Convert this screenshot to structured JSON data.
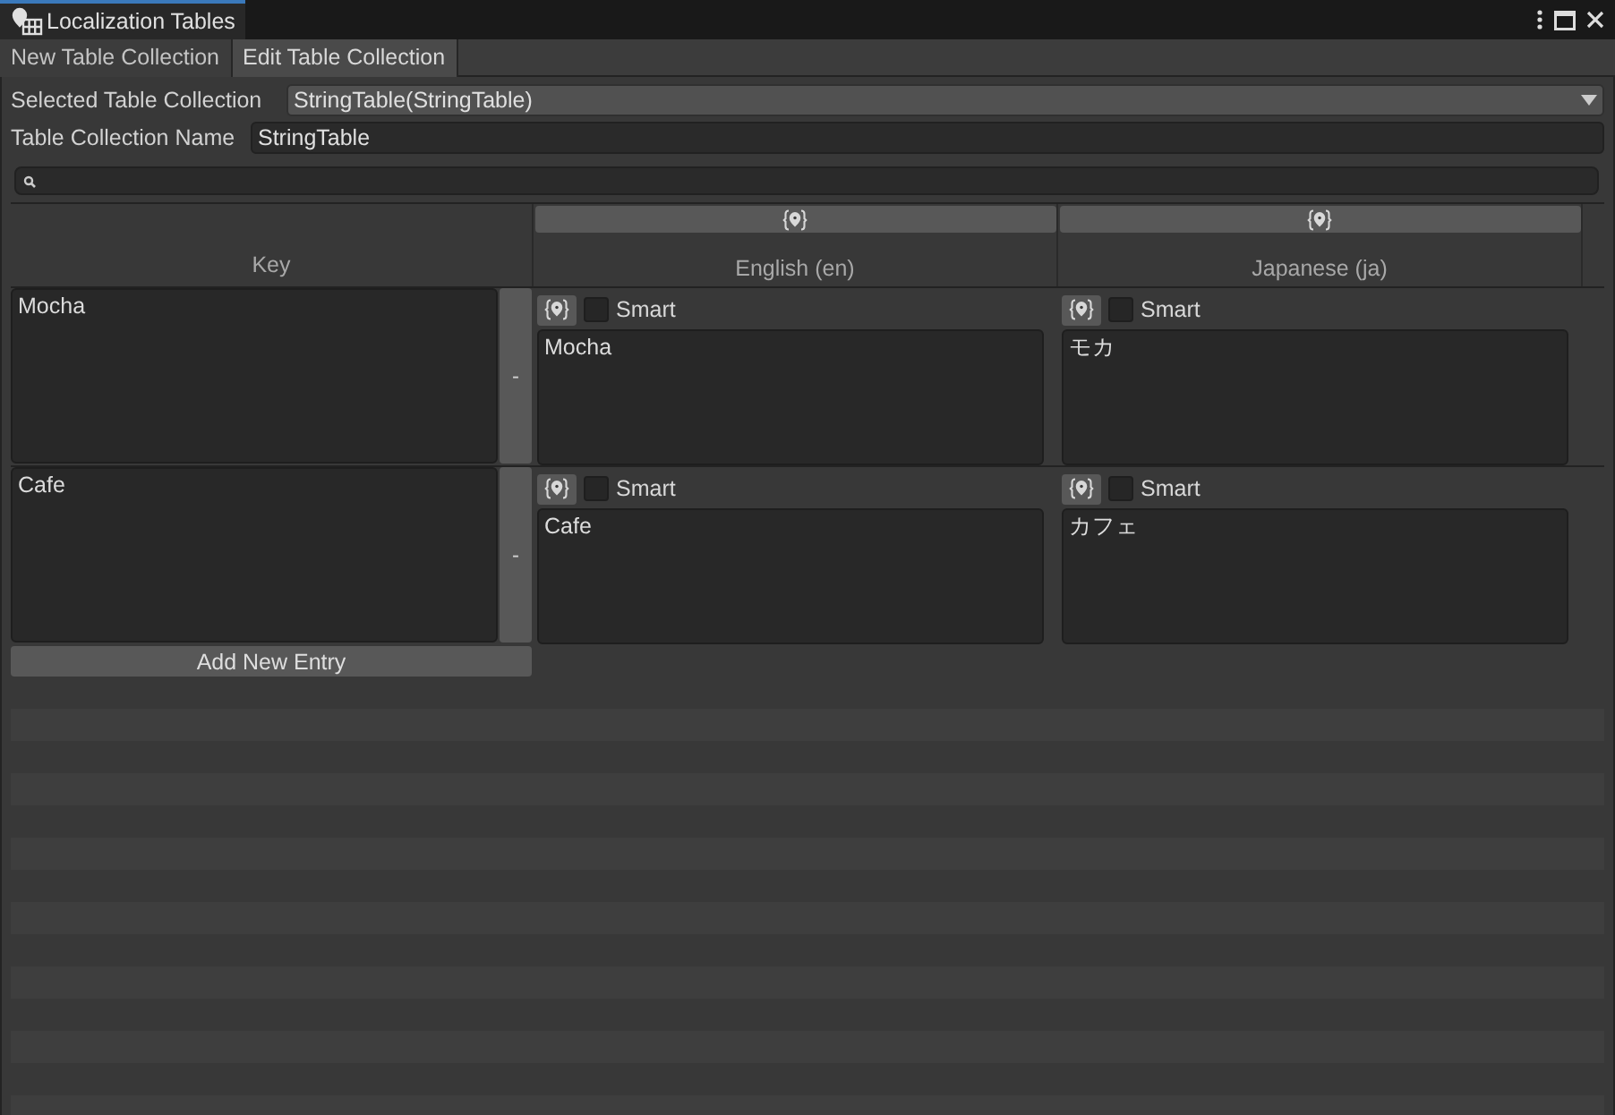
{
  "window": {
    "title": "Localization Tables"
  },
  "tabs": [
    {
      "label": "New Table Collection",
      "selected": false
    },
    {
      "label": "Edit Table Collection",
      "selected": true
    }
  ],
  "selected_table_collection": {
    "label": "Selected Table Collection",
    "value": "StringTable(StringTable)"
  },
  "table_collection_name": {
    "label": "Table Collection Name",
    "value": "StringTable"
  },
  "table": {
    "columns": [
      "Key",
      "English (en)",
      "Japanese (ja)"
    ],
    "rows": [
      {
        "key": "Mocha",
        "remove": "-",
        "cells": [
          {
            "smart_label": "Smart",
            "smart": false,
            "value": "Mocha"
          },
          {
            "smart_label": "Smart",
            "smart": false,
            "value": "モカ"
          }
        ]
      },
      {
        "key": "Cafe",
        "remove": "-",
        "cells": [
          {
            "smart_label": "Smart",
            "smart": false,
            "value": "Cafe"
          },
          {
            "smart_label": "Smart",
            "smart": false,
            "value": "カフェ"
          }
        ]
      }
    ],
    "add_button": "Add New Entry"
  }
}
